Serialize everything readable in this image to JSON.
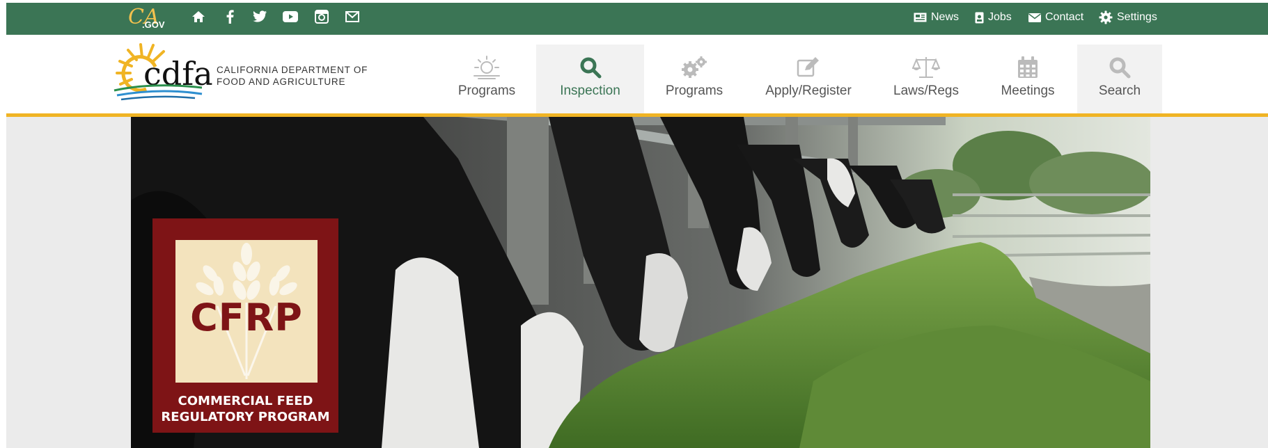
{
  "utility_bar": {
    "ca_logo_text": "CA",
    "ca_logo_suffix": ".GOV",
    "social_icons": [
      "home-icon",
      "facebook-icon",
      "twitter-icon",
      "youtube-icon",
      "instagram-icon",
      "email-icon"
    ],
    "links": [
      {
        "label": "News",
        "icon": "newspaper-icon"
      },
      {
        "label": "Jobs",
        "icon": "id-badge-icon"
      },
      {
        "label": "Contact",
        "icon": "envelope-icon"
      },
      {
        "label": "Settings",
        "icon": "gear-icon"
      }
    ]
  },
  "header": {
    "logo_text": "cdfa",
    "org_name_line1": "CALIFORNIA DEPARTMENT OF",
    "org_name_line2": "FOOD AND AGRICULTURE",
    "nav": [
      {
        "label": "Programs",
        "icon": "sun-icon",
        "active": false
      },
      {
        "label": "Inspection",
        "icon": "search-icon",
        "active": true
      },
      {
        "label": "Programs",
        "icon": "gears-icon",
        "active": false
      },
      {
        "label": "Apply/Register",
        "icon": "edit-icon",
        "active": false
      },
      {
        "label": "Laws/Regs",
        "icon": "scales-icon",
        "active": false
      },
      {
        "label": "Meetings",
        "icon": "calendar-icon",
        "active": false
      },
      {
        "label": "Search",
        "icon": "search-icon",
        "active": false
      }
    ]
  },
  "hero": {
    "badge_acronym": "CFRP",
    "badge_caption_line1": "COMMERCIAL FEED",
    "badge_caption_line2": "REGULATORY PROGRAM"
  },
  "colors": {
    "utility_green": "#3b7555",
    "accent_gold": "#f0b424",
    "badge_red": "#7e1416",
    "badge_cream": "#f3e3bd"
  }
}
